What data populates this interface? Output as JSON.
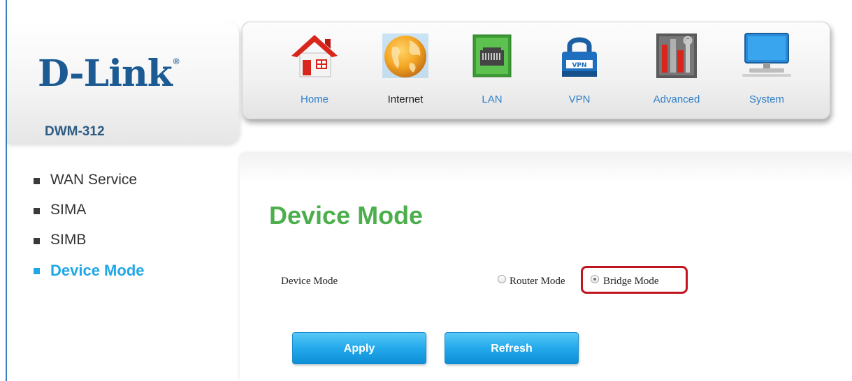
{
  "brand": {
    "logo": "D-Link",
    "trademark": "®",
    "model": "DWM-312"
  },
  "nav": [
    {
      "label": "Home",
      "icon": "home-icon"
    },
    {
      "label": "Internet",
      "icon": "globe-icon"
    },
    {
      "label": "LAN",
      "icon": "lan-port-icon"
    },
    {
      "label": "VPN",
      "icon": "vpn-lock-icon"
    },
    {
      "label": "Advanced",
      "icon": "tools-icon"
    },
    {
      "label": "System",
      "icon": "monitor-icon"
    }
  ],
  "nav_active": "Internet",
  "sidebar": {
    "items": [
      {
        "label": "WAN Service"
      },
      {
        "label": "SIMA"
      },
      {
        "label": "SIMB"
      },
      {
        "label": "Device Mode"
      }
    ],
    "active": "Device Mode"
  },
  "main": {
    "title": "Device Mode",
    "field_label": "Device Mode",
    "options": [
      {
        "label": "Router Mode",
        "checked": false
      },
      {
        "label": "Bridge Mode",
        "checked": true
      }
    ],
    "apply_label": "Apply",
    "refresh_label": "Refresh"
  },
  "colors": {
    "brand_blue": "#1b5a92",
    "title_green": "#4cae4c",
    "active_blue": "#1fa7e6",
    "link_blue": "#2f7fc9",
    "highlight_red": "#c0141f"
  }
}
